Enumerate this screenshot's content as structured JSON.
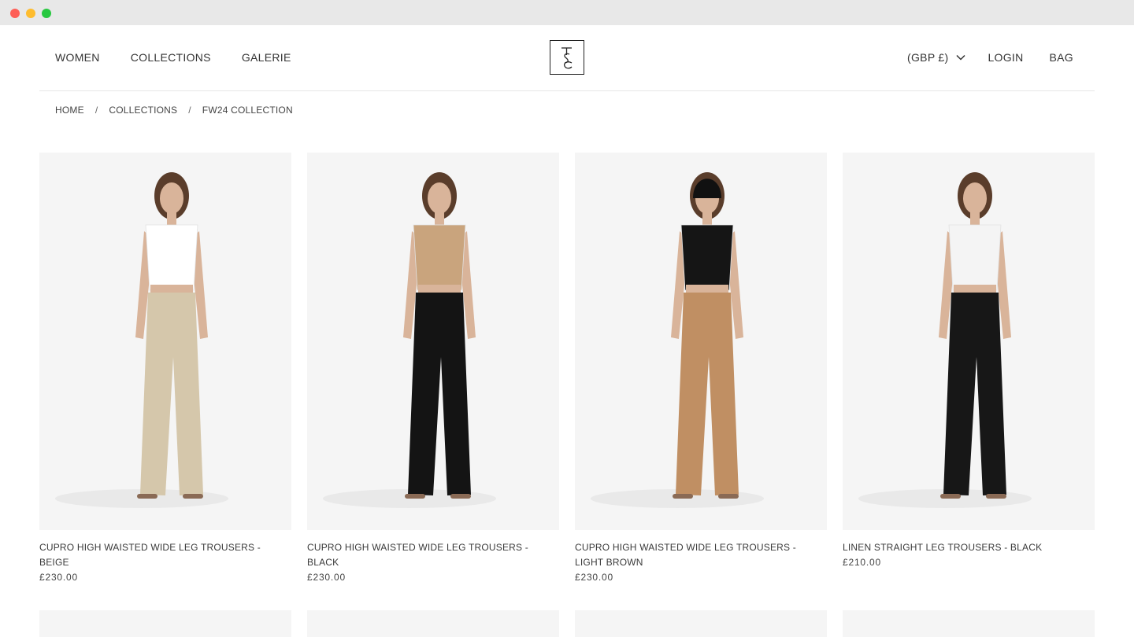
{
  "header": {
    "nav": [
      "WOMEN",
      "COLLECTIONS",
      "GALERIE"
    ],
    "currency": "(GBP £)",
    "login": "LOGIN",
    "bag": "BAG",
    "logo_text": "TSC"
  },
  "breadcrumb": [
    "HOME",
    "COLLECTIONS",
    "FW24 COLLECTION"
  ],
  "products": [
    {
      "name": "CUPRO HIGH WAISTED WIDE LEG TROUSERS - BEIGE",
      "price": "£230.00",
      "top_color": "#ffffff",
      "trouser_color": "#d5c7ab",
      "hat": false
    },
    {
      "name": "CUPRO HIGH WAISTED WIDE LEG TROUSERS - BLACK",
      "price": "£230.00",
      "top_color": "#c9a47d",
      "trouser_color": "#141414",
      "hat": false
    },
    {
      "name": "CUPRO HIGH WAISTED WIDE LEG TROUSERS - LIGHT BROWN",
      "price": "£230.00",
      "top_color": "#151515",
      "trouser_color": "#c08f63",
      "hat": true
    },
    {
      "name": "LINEN STRAIGHT LEG TROUSERS - BLACK",
      "price": "£210.00",
      "top_color": "#f4f4f4",
      "trouser_color": "#171717",
      "hat": false
    }
  ]
}
